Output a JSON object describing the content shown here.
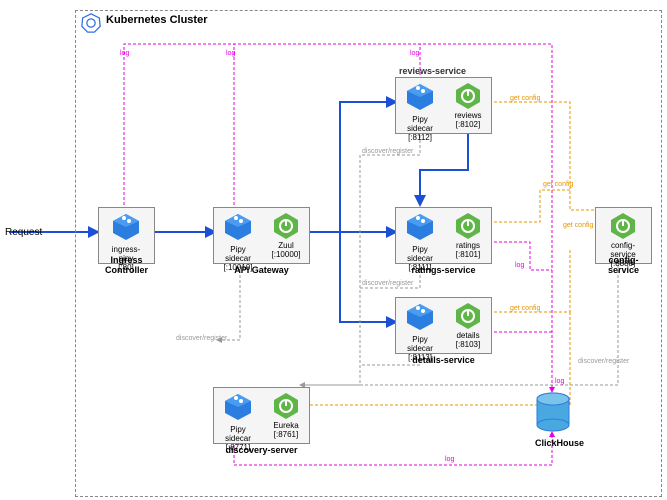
{
  "cluster_title": "Kubernetes Cluster",
  "request": "Request",
  "groups": {
    "ingress": {
      "label": "Ingress Controller",
      "sidecar": "ingress-pipy",
      "sidecar_port": "[:80]"
    },
    "gateway": {
      "label": "API Gateway",
      "sidecar": "Pipy sidecar",
      "sidecar_port": "[:10010]",
      "app": "Zuul",
      "app_port": "[:10000]"
    },
    "reviews": {
      "title": "reviews-service",
      "sidecar": "Pipy sidecar",
      "sidecar_port": "[:8112]",
      "app": "reviews",
      "app_port": "[:8102]"
    },
    "ratings": {
      "title": "ratings-service",
      "sidecar": "Pipy sidecar",
      "sidecar_port": "[:8111]",
      "app": "ratings",
      "app_port": "[:8101]"
    },
    "details": {
      "title": "details-service",
      "sidecar": "Pipy sidecar",
      "sidecar_port": "[:8113]",
      "app": "details",
      "app_port": "[:8103]"
    },
    "config": {
      "label": "config-service",
      "app": "config-service",
      "app_port": "[:8888]"
    },
    "discovery": {
      "label": "discovery-server",
      "sidecar": "Pipy sidecar",
      "sidecar_port": "[:8771]",
      "app": "Eureka",
      "app_port": "[:8761]"
    },
    "clickhouse": {
      "label": "ClickHouse"
    }
  },
  "edge_labels": {
    "log": "log",
    "discover": "discover/register",
    "getconfig": "get config"
  }
}
